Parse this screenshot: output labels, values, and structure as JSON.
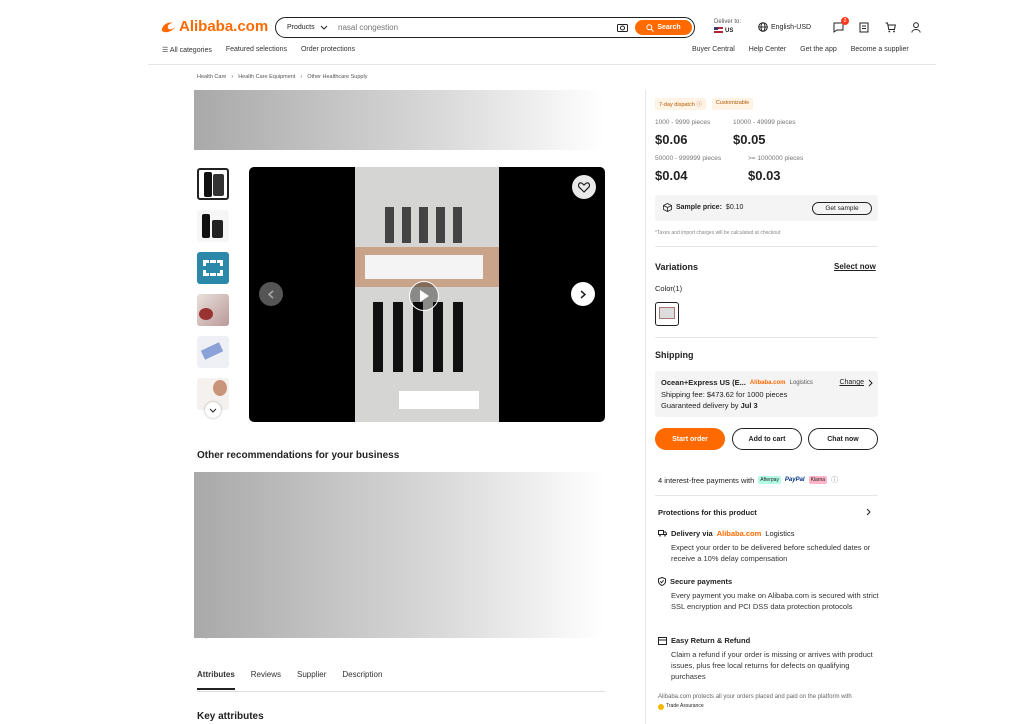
{
  "header": {
    "logo": "Alibaba.com",
    "search": {
      "category": "Products",
      "placeholder": "nasal congestion",
      "button": "Search"
    },
    "deliver_to": "Deliver to:",
    "country": "US",
    "language": "English-USD",
    "message_count": "2",
    "nav_left": [
      "All categories",
      "Featured selections",
      "Order protections"
    ],
    "nav_right": [
      "Buyer Central",
      "Help Center",
      "Get the app",
      "Become a supplier"
    ]
  },
  "breadcrumb": [
    "Health Care",
    "Health Care Equipment",
    "Other Healthcare Supply"
  ],
  "gallery": {
    "thumb_count": 6
  },
  "recommendations_title": "Other recommendations for your business",
  "obscured_fragment": "Easy Return",
  "tabs": [
    "Attributes",
    "Reviews",
    "Supplier",
    "Description"
  ],
  "key_attributes": "Key attributes",
  "product": {
    "tags": [
      "7-day dispatch",
      "Customizable"
    ],
    "tiers": [
      {
        "range": "1000 - 9999 pieces",
        "price": "$0.06"
      },
      {
        "range": "10000 - 49999 pieces",
        "price": "$0.05"
      },
      {
        "range": "50000 - 999999 pieces",
        "price": "$0.04"
      },
      {
        "range": ">= 1000000 pieces",
        "price": "$0.03"
      }
    ],
    "sample_label": "Sample price:",
    "sample_price": "$0.10",
    "sample_button": "Get sample",
    "tax_note": "*Taxes and import charges will be calculated at checkout",
    "variations": "Variations",
    "select_now": "Select now",
    "color_label": "Color(1)",
    "shipping": "Shipping",
    "ship_method": "Ocean+Express US (E...",
    "ship_brand": "Alibaba.com",
    "ship_logistics": "Logistics",
    "ship_change": "Change",
    "ship_fee": "Shipping fee: $473.62 for 1000 pieces",
    "ship_guarantee_prefix": "Guaranteed delivery by",
    "ship_guarantee_date": "Jul 3",
    "buttons": {
      "start_order": "Start order",
      "add_to_cart": "Add to cart",
      "chat_now": "Chat now"
    },
    "payments": "4 interest-free payments with",
    "pay_brands": [
      "Afterpay",
      "PayPal",
      "Klarna"
    ],
    "protections_title": "Protections for this product",
    "protections": [
      {
        "title_prefix": "Delivery via",
        "brand": "Alibaba.com",
        "title_suffix": "Logistics",
        "desc": "Expect your order to be delivered before scheduled dates or receive a 10% delay compensation"
      },
      {
        "title": "Secure payments",
        "desc": "Every payment you make on Alibaba.com is secured with strict SSL encryption and PCI DSS data protection protocols"
      },
      {
        "title": "Easy Return & Refund",
        "desc": "Claim a refund if your order is missing or arrives with product issues, plus free local returns for defects on qualifying purchases"
      }
    ],
    "assurance_note": "Alibaba.com protects all your orders placed and paid on the platform with",
    "trade_assurance": "Trade Assurance"
  },
  "colors": {
    "brand": "#ff6a00"
  }
}
